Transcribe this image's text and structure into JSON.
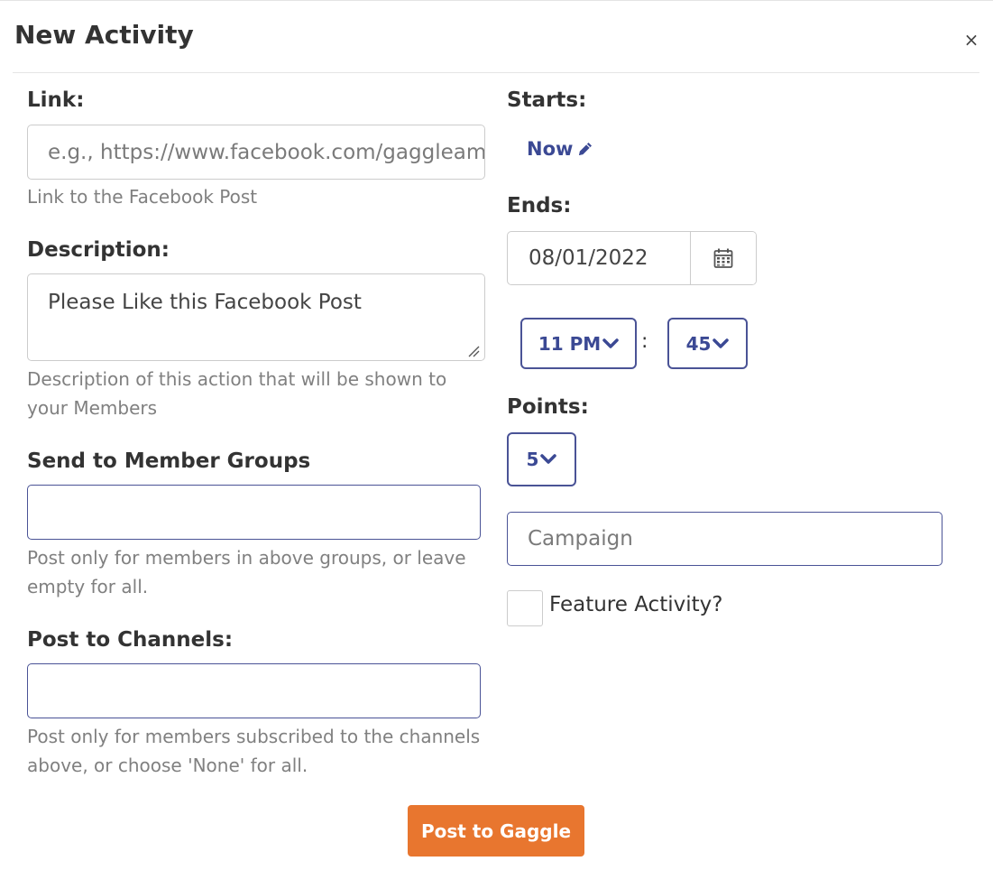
{
  "modal": {
    "title": "New Activity",
    "close": "×"
  },
  "link": {
    "label": "Link:",
    "placeholder": "e.g., https://www.facebook.com/gaggleamp",
    "help": "Link to the Facebook Post"
  },
  "description": {
    "label": "Description:",
    "value": "Please Like this Facebook Post",
    "help_line1": "Description of this action that will be shown to",
    "help_line2": "your Members"
  },
  "member_groups": {
    "label": "Send to Member Groups",
    "value": "",
    "help_line1": "Post only for members in above groups, or leave",
    "help_line2": "empty for all."
  },
  "channels": {
    "label": "Post to Channels:",
    "value": "",
    "help_line1": "Post only for members subscribed to the channels",
    "help_line2": "above, or choose 'None' for all."
  },
  "starts": {
    "label": "Starts:",
    "value": "Now",
    "edit_icon": "pencil-icon"
  },
  "ends": {
    "label": "Ends:",
    "date": "08/01/2022",
    "calendar_icon": "calendar-icon",
    "hour": "11 PM",
    "separator": ":",
    "minute": "45"
  },
  "points": {
    "label": "Points:",
    "value": "5"
  },
  "campaign": {
    "placeholder": "Campaign",
    "value": ""
  },
  "feature": {
    "label": "Feature Activity?",
    "checked": false
  },
  "submit": {
    "label": "Post to Gaggle"
  },
  "colors": {
    "accent_blue": "#3b4994",
    "submit_orange": "#e8762f",
    "help_gray": "#808080"
  }
}
